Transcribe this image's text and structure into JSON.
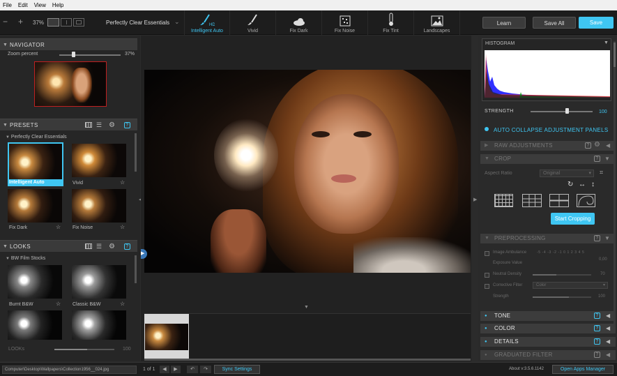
{
  "menu": [
    "File",
    "Edit",
    "View",
    "Help"
  ],
  "toolbar": {
    "zoom": "37%",
    "preset_dropdown": "Perfectly Clear Essentials",
    "learn": "Learn",
    "save_all": "Save All",
    "save": "Save"
  },
  "presets_bar": [
    {
      "label": "Intelligent Auto",
      "icon": "hd-brush-icon",
      "active": true
    },
    {
      "label": "Vivid",
      "icon": "brush-icon"
    },
    {
      "label": "Fix Dark",
      "icon": "cloud-icon"
    },
    {
      "label": "Fix Noise",
      "icon": "noise-icon"
    },
    {
      "label": "Fix Tint",
      "icon": "thermometer-icon"
    },
    {
      "label": "Landscapes",
      "icon": "landscape-icon"
    }
  ],
  "navigator": {
    "title": "NAVIGATOR",
    "zoom_label": "Zoom percent",
    "zoom_value": "37%",
    "zoom_fraction": 0.2
  },
  "presets": {
    "title": "PRESETS",
    "group": "Perfectly Clear Essentials",
    "items": [
      {
        "label": "Intelligent Auto",
        "selected": true
      },
      {
        "label": "Vivid"
      },
      {
        "label": "Fix Dark"
      },
      {
        "label": "Fix Noise"
      }
    ]
  },
  "looks": {
    "title": "LOOKS",
    "group": "BW Film Stocks",
    "items": [
      {
        "label": "Burnt B&W"
      },
      {
        "label": "Classic B&W"
      }
    ],
    "slider_label": "LOOKs",
    "slider_value": "100",
    "slider_fraction": 0.55
  },
  "right": {
    "histogram": "HISTOGRAM",
    "strength_label": "STRENGTH",
    "strength_value": "100",
    "strength_fraction": 0.45,
    "auto_collapse": "AUTO COLLAPSE ADJUSTMENT PANELS",
    "raw": "RAW ADJUSTMENTS",
    "crop": "CROP",
    "aspect_ratio": "Aspect Ratio",
    "aspect_value": "Original",
    "start_cropping": "Start Cropping",
    "preprocessing": "PREPROCESSING",
    "image_ambulance": "Image Ambulance",
    "ambulance_scale": "-5 -4 -3 -2 -1 0 1 2 3 4 5",
    "exposure_value_label": "Exposure Value",
    "exposure_value": "0,00",
    "neutral_density": "Neutral Density",
    "neutral_value": "70",
    "corrective_filter": "Corrective Filter",
    "filter_value": "Color",
    "strength_small": "Strength",
    "strength_small_value": "100",
    "tone": "TONE",
    "color": "COLOR",
    "details": "DETAILS",
    "graduated": "GRADUATED FILTER"
  },
  "status": {
    "filename": "Computer\\Desktop\\Wallpapers\\Collection1956__024.jpg",
    "page": "1 of 1",
    "sync": "Sync Settings",
    "about": "About v:3.5.6.1142",
    "apps": "Open Apps Manager"
  }
}
